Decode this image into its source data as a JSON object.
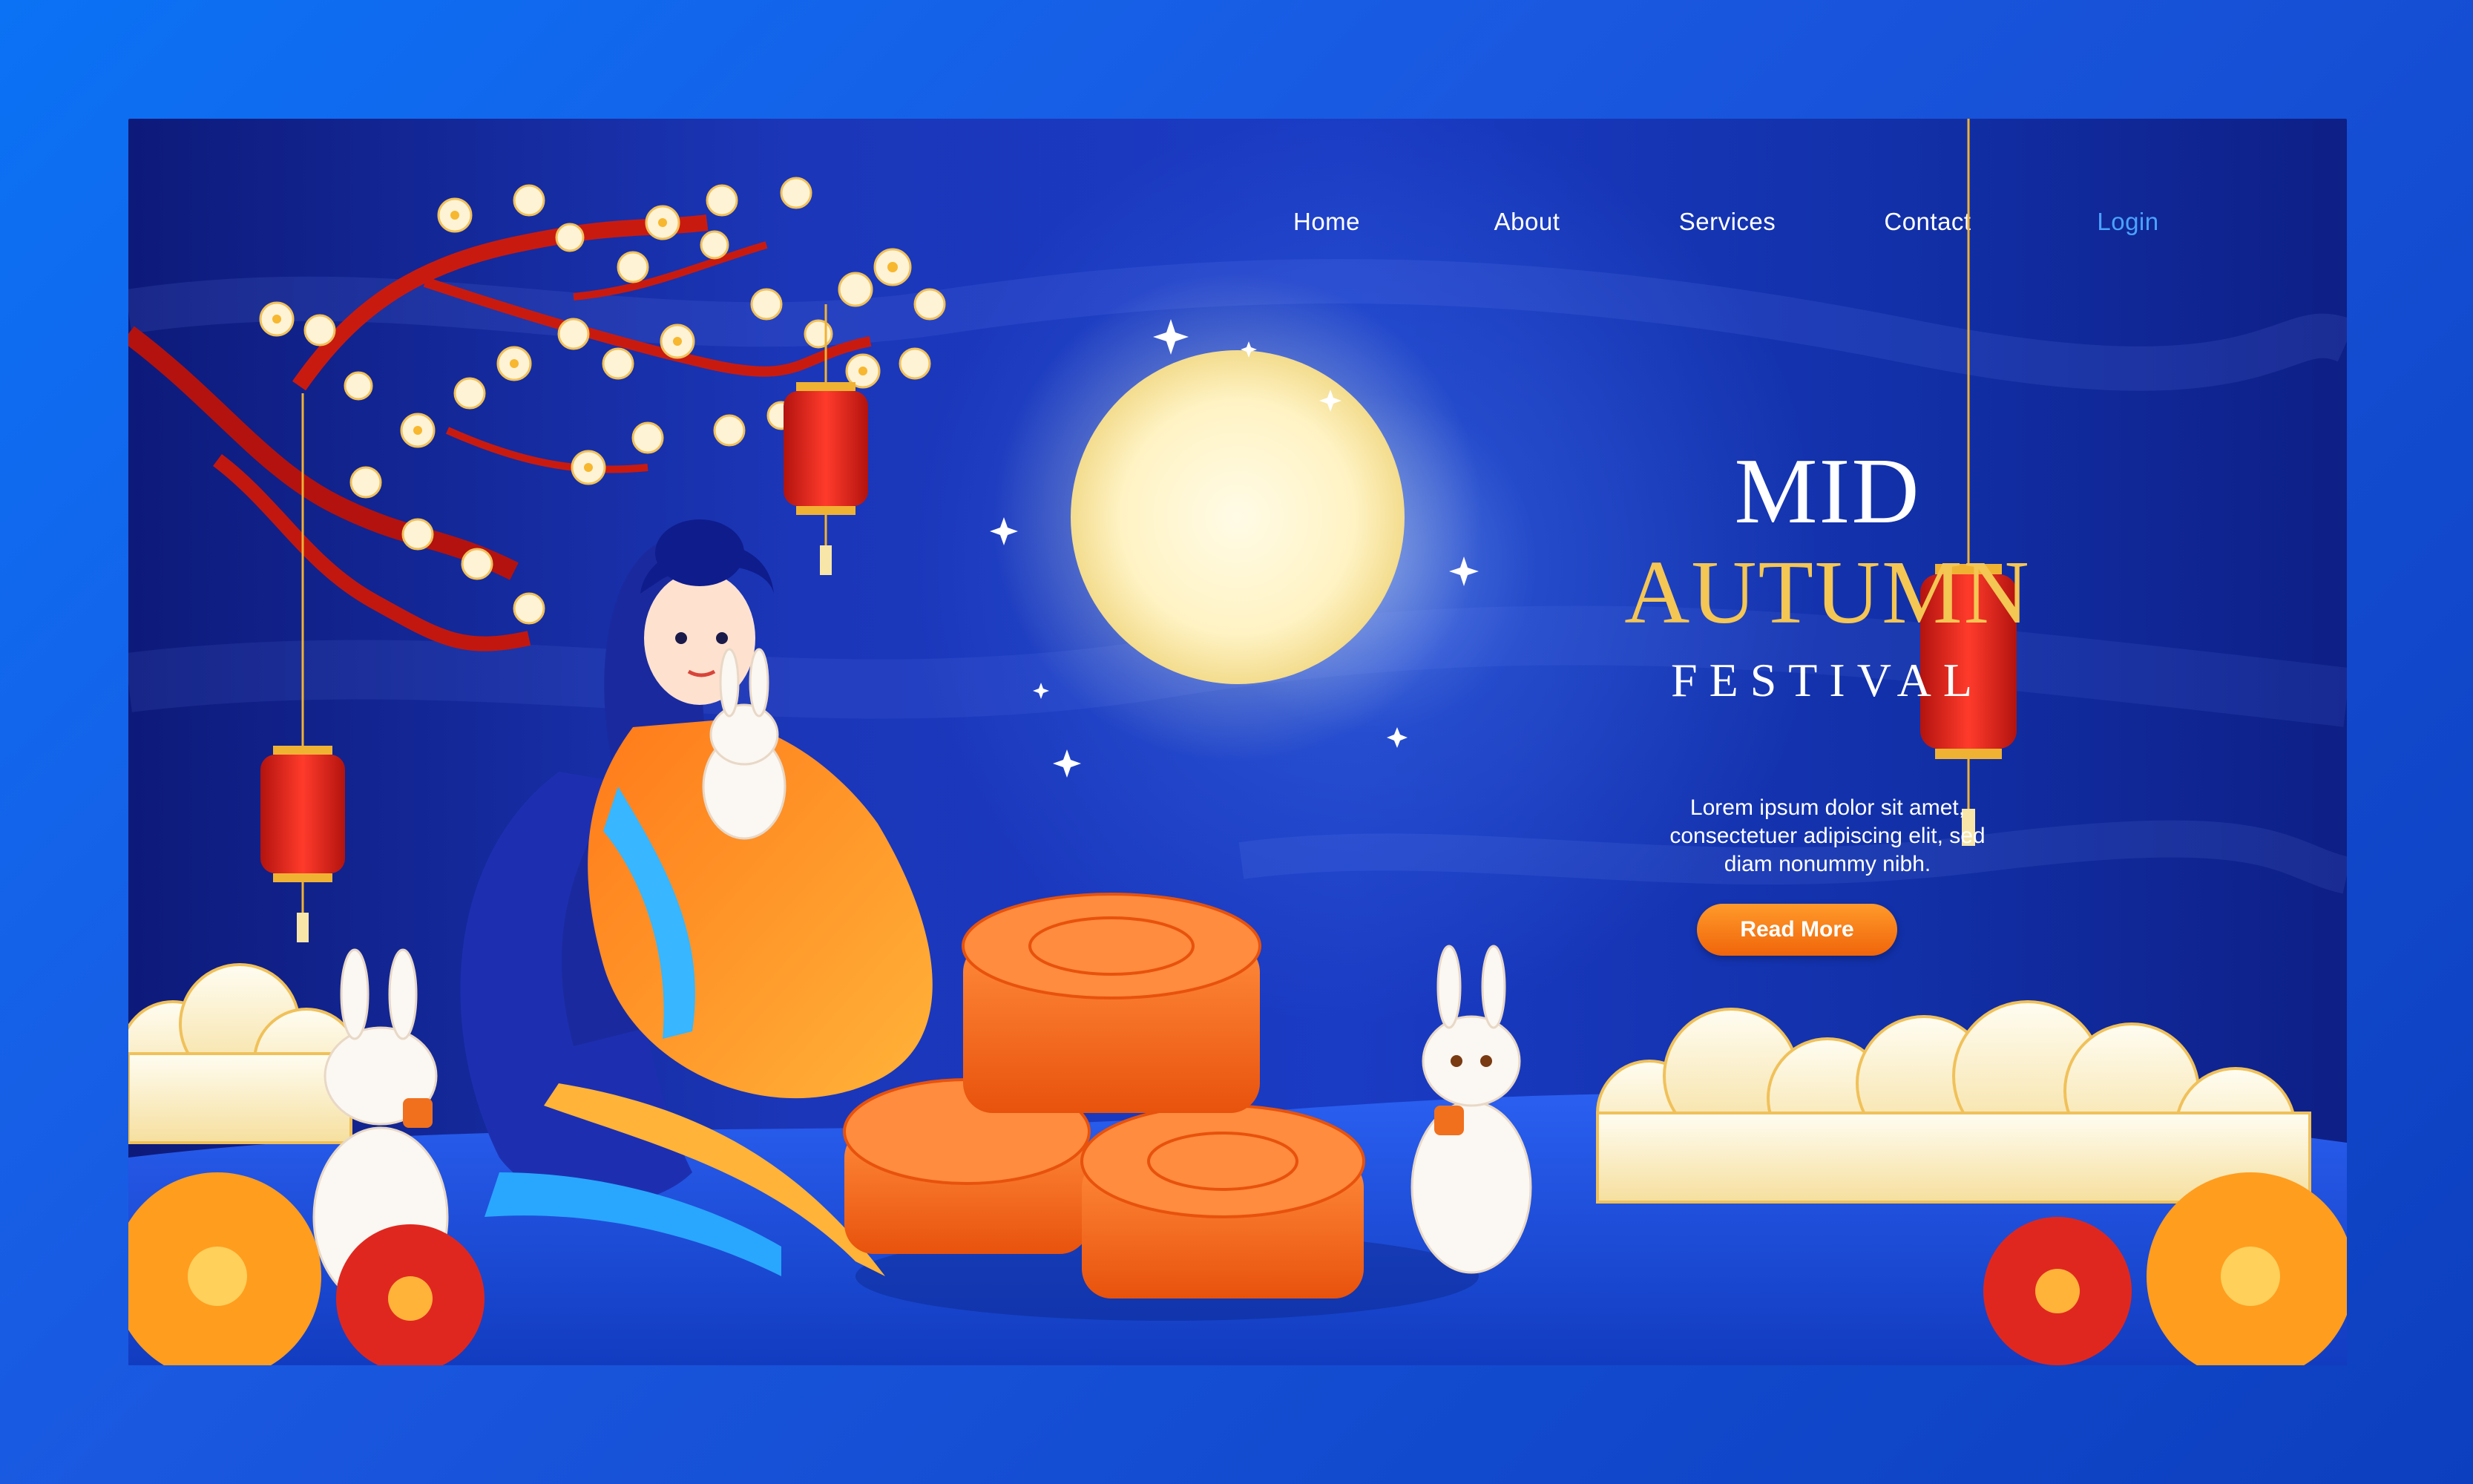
{
  "nav": {
    "items": [
      "Home",
      "About",
      "Services",
      "Contact"
    ],
    "login": "Login"
  },
  "hero": {
    "title_line1": "MID",
    "title_line2": "AUTUMN",
    "title_line3": "FESTIVAL",
    "description_line1": "Lorem ipsum dolor sit amet,",
    "description_line2": "consectetuer adipiscing elit, sed",
    "description_line3": "diam nonummy nibh.",
    "cta_label": "Read More"
  },
  "colors": {
    "outer_bg": "#1463ea",
    "night_sky": "#1a36b8",
    "title_gold": "#f4c653",
    "login_blue": "#4aa3ff",
    "button_orange": "#f37a14",
    "lantern_red": "#e0271f",
    "mooncake": "#f0701e"
  },
  "icons": [
    "full-moon-icon",
    "lantern-icon",
    "rabbit-icon",
    "mooncake-icon",
    "blossom-branch-icon",
    "cloud-icon",
    "flower-icon",
    "sparkle-star-icon"
  ]
}
